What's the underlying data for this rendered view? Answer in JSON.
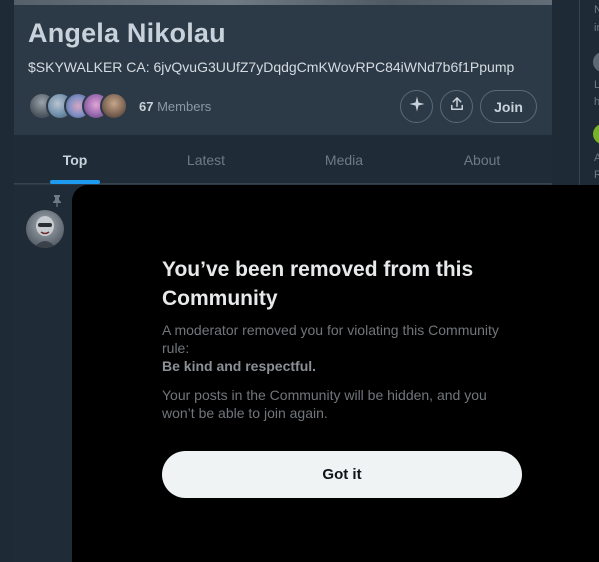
{
  "community": {
    "name": "Angela Nikolau",
    "ca_line": "$SKYWALKER CA: 6jvQvuG3UUfZ7yDqdgCmKWovRPC84iWNd7b6f1Ppump",
    "member_count": "67",
    "members_label": "Members",
    "join_label": "Join"
  },
  "tabs": [
    {
      "label": "Top",
      "active": true
    },
    {
      "label": "Latest",
      "active": false
    },
    {
      "label": "Media",
      "active": false
    },
    {
      "label": "About",
      "active": false
    }
  ],
  "right_fragments": [
    "N",
    "ir",
    "L",
    "h",
    "A",
    "R"
  ],
  "modal": {
    "title": "You’ve been removed from this Community",
    "description": "A moderator removed you for violating this Community rule:",
    "rule": "Be kind and respectful.",
    "note": "Your posts in the Community will be hidden, and you won’t be able to join again.",
    "button_label": "Got it"
  },
  "colors": {
    "accent": "#1d9bf0",
    "modal_bg": "#000000",
    "button_bg": "#eff3f4"
  },
  "icons": [
    "sparkle-icon",
    "share-icon",
    "pin-icon"
  ]
}
